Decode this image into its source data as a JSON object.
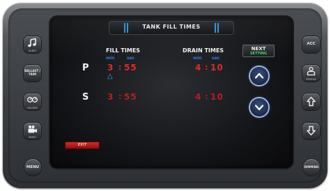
{
  "screen": {
    "title": "TANK FILL TIMES",
    "fill_header": "FILL TIMES",
    "drain_header": "DRAIN TIMES",
    "unit_min": "min",
    "unit_sec": "sec",
    "next_button": {
      "line1": "NEXT",
      "line2": "SETTING"
    },
    "rows": [
      {
        "label": "P",
        "fill_min": "3",
        "fill_sec": "55",
        "drain_min": "4",
        "drain_sec": "10"
      },
      {
        "label": "S",
        "fill_min": "3",
        "fill_sec": "55",
        "drain_min": "4",
        "drain_sec": "10"
      }
    ],
    "delta_symbol": "△",
    "red_bar_label": "EXIT"
  },
  "left_buttons": {
    "audio": "AUDIO",
    "ballast": "BALLAST / TRIM",
    "gauges": "GAUGES",
    "video": "VIDEO",
    "menu": "MENU"
  },
  "right_buttons": {
    "acc": "ACC",
    "profile": "PROFILE",
    "dimming": "DIMMING"
  },
  "colors": {
    "accent_blue": "#2d9bd6",
    "value_red": "#e02a2a",
    "unit_blue": "#2f7be6",
    "setting_green": "#49d36a"
  }
}
